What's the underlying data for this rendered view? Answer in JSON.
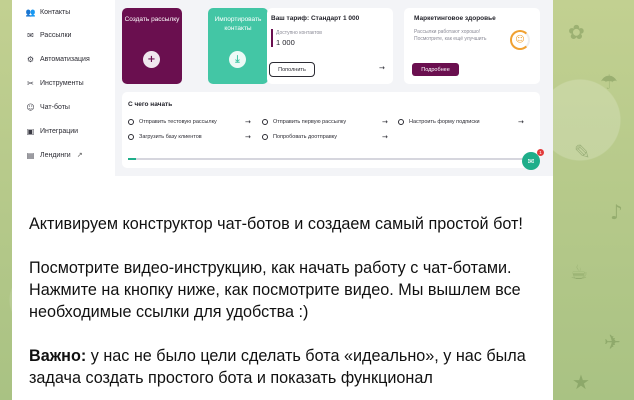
{
  "sidebar": {
    "items": [
      {
        "label": "Контакты",
        "icon": "contacts-icon",
        "glyph": "👥"
      },
      {
        "label": "Рассылки",
        "icon": "mail-icon",
        "glyph": "✉"
      },
      {
        "label": "Автоматизация",
        "icon": "automation-icon",
        "glyph": "⚙"
      },
      {
        "label": "Инструменты",
        "icon": "tools-icon",
        "glyph": "✂"
      },
      {
        "label": "Чат-боты",
        "icon": "chatbot-icon",
        "glyph": "☺"
      },
      {
        "label": "Интеграции",
        "icon": "integrations-icon",
        "glyph": "▣"
      },
      {
        "label": "Лендинги",
        "icon": "landing-icon",
        "glyph": "▤"
      }
    ]
  },
  "tiles": {
    "create": {
      "label": "Создать рассылку",
      "color": "#6a0f4f",
      "icon": "plus-icon",
      "glyph": "+"
    },
    "import": {
      "label": "Импортировать контакты",
      "color": "#43c6a5",
      "icon": "download-icon",
      "glyph": "⤓"
    }
  },
  "tariff": {
    "title": "Ваш тариф: Стандарт 1 000",
    "available_label": "Доступно контактов",
    "available_value": "1 000",
    "button": "Пополнить",
    "arrow": "→"
  },
  "health": {
    "title": "Маркетинговое здоровье",
    "text": "Рассылки работают хорошо! Посмотрите, как ещё улучшить",
    "button": "Подробнее"
  },
  "start": {
    "title": "С чего начать",
    "steps": [
      "Отправить тестовую рассылку",
      "Отправить первую рассылку",
      "Настроить форму подписки",
      "Загрузить базу клиентов",
      "Попробовать доотправку"
    ],
    "arrow": "→"
  },
  "chat_badge": "1",
  "message": {
    "p1": "Активируем конструктор чат-ботов и создаем самый простой бот!",
    "p2": "Посмотрите видео-инструкцию, как начать работу с чат-ботами. Нажмите на кнопку ниже, как посмотрите видео. Мы вышлем все необходимые ссылки для удобства :)",
    "p3_bold": "Важно:",
    "p3_rest": " у нас не было цели сделать бота «идеально», у нас была задача создать простого бота и показать функционал"
  },
  "colors": {
    "accent_dark": "#6a0f4f",
    "accent_green": "#43c6a5",
    "fab": "#1fae8a",
    "wallpaper": "#b9c98e"
  }
}
